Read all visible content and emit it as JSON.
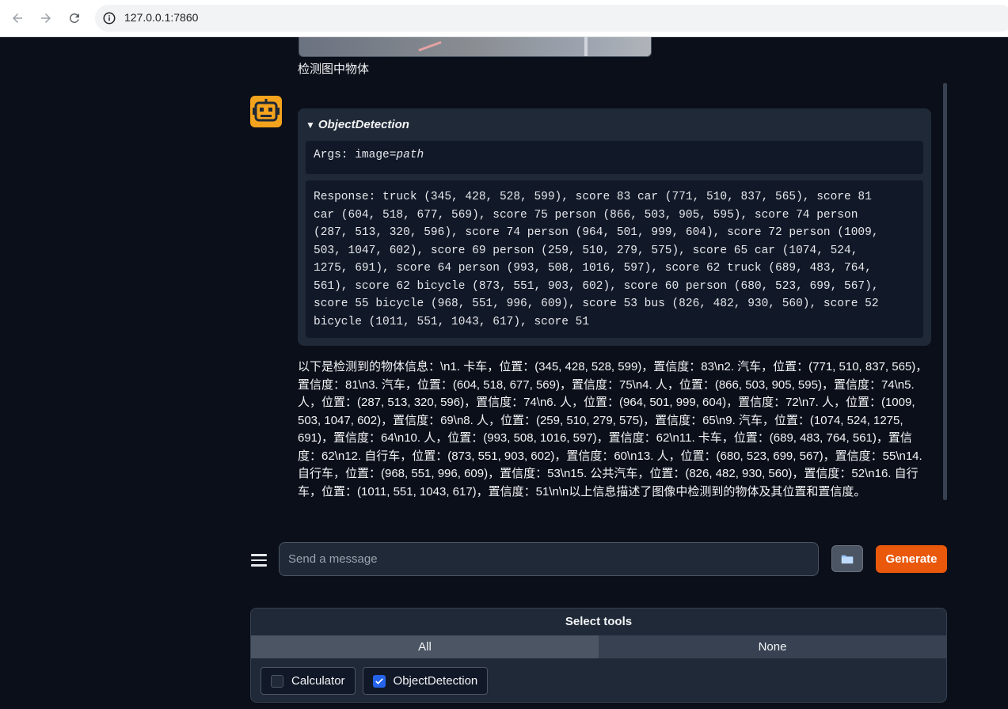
{
  "browser": {
    "url": "127.0.0.1:7860"
  },
  "chat": {
    "user_message": "检测图中物体",
    "tool_call": {
      "name": "ObjectDetection",
      "args_prefix": "Args: image=",
      "args_value": "path",
      "response": "Response: truck (345, 428, 528, 599), score 83 car (771, 510, 837, 565), score 81\ncar (604, 518, 677, 569), score 75 person (866, 503, 905, 595), score 74 person\n(287, 513, 320, 596), score 74 person (964, 501, 999, 604), score 72 person (1009,\n503, 1047, 602), score 69 person (259, 510, 279, 575), score 65 car (1074, 524,\n1275, 691), score 64 person (993, 508, 1016, 597), score 62 truck (689, 483, 764,\n561), score 62 bicycle (873, 551, 903, 602), score 60 person (680, 523, 699, 567),\nscore 55 bicycle (968, 551, 996, 609), score 53 bus (826, 482, 930, 560), score 52\nbicycle (1011, 551, 1043, 617), score 51"
    },
    "bot_answer": "以下是检测到的物体信息：\\n1. 卡车，位置：(345, 428, 528, 599)，置信度：83\\n2. 汽车，位置：(771, 510, 837, 565)，置信度：81\\n3. 汽车，位置：(604, 518, 677, 569)，置信度：75\\n4. 人，位置：(866, 503, 905, 595)，置信度：74\\n5. 人，位置：(287, 513, 320, 596)，置信度：74\\n6. 人，位置：(964, 501, 999, 604)，置信度：72\\n7. 人，位置：(1009, 503, 1047, 602)，置信度：69\\n8. 人，位置：(259, 510, 279, 575)，置信度：65\\n9. 汽车，位置：(1074, 524, 1275, 691)，置信度：64\\n10. 人，位置：(993, 508, 1016, 597)，置信度：62\\n11. 卡车，位置：(689, 483, 764, 561)，置信度：62\\n12. 自行车，位置：(873, 551, 903, 602)，置信度：60\\n13. 人，位置：(680, 523, 699, 567)，置信度：55\\n14. 自行车，位置：(968, 551, 996, 609)，置信度：53\\n15. 公共汽车，位置：(826, 482, 930, 560)，置信度：52\\n16. 自行车，位置：(1011, 551, 1043, 617)，置信度：51\\n\\n以上信息描述了图像中检测到的物体及其位置和置信度。"
  },
  "input": {
    "placeholder": "Send a message",
    "generate_label": "Generate"
  },
  "tools_panel": {
    "title": "Select tools",
    "all_label": "All",
    "none_label": "None",
    "tools": [
      {
        "label": "Calculator",
        "checked": false
      },
      {
        "label": "ObjectDetection",
        "checked": true
      }
    ]
  },
  "colors": {
    "accent": "#ea580c",
    "bot_avatar": "#f4a31c",
    "checkbox_checked": "#2563eb"
  },
  "icons": [
    "back-arrow-icon",
    "forward-arrow-icon",
    "reload-icon",
    "site-info-icon",
    "robot-icon",
    "menu-icon",
    "folder-icon",
    "check-icon"
  ]
}
